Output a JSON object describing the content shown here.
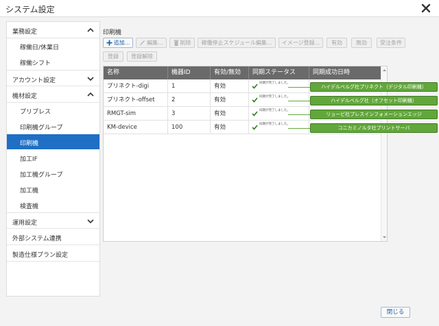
{
  "window": {
    "title": "システム設定"
  },
  "sidebar": {
    "sections": [
      {
        "label": "業務設定",
        "expanded": true,
        "items": [
          "稼働日/休業日",
          "稼働シフト"
        ]
      },
      {
        "label": "アカウント設定",
        "expanded": false,
        "items": []
      },
      {
        "label": "機材設定",
        "expanded": true,
        "items": [
          "プリプレス",
          "印刷機グループ",
          "印刷機",
          "加工IF",
          "加工機グループ",
          "加工機",
          "検査機"
        ]
      },
      {
        "label": "運用設定",
        "expanded": false,
        "items": []
      },
      {
        "label": "外部システム連携",
        "expanded": false,
        "items": []
      },
      {
        "label": "製造仕様プラン設定",
        "expanded": false,
        "items": []
      }
    ],
    "active_item": "印刷機"
  },
  "main": {
    "section_title": "印刷機",
    "toolbar": {
      "add": "追加...",
      "edit": "編集...",
      "delete": "削除",
      "schedule": "稼働停止スケジュール編集...",
      "image_register": "イメージ登録...",
      "enable": "有効",
      "disable": "無効",
      "order_condition": "受注条件",
      "register": "登録",
      "unregister": "登録解除"
    },
    "table": {
      "columns": [
        "名称",
        "機器ID",
        "有効/無効",
        "同期ステータス",
        "同期成功日時"
      ],
      "rows": [
        {
          "name": "プリネクト-digi",
          "id": "1",
          "enabled": "有効",
          "status": "同期が完了しました。",
          "synced_at": ""
        },
        {
          "name": "プリネクト-offset",
          "id": "2",
          "enabled": "有効",
          "status": "同期が完了しました。",
          "synced_at": ""
        },
        {
          "name": "RMGT-sim",
          "id": "3",
          "enabled": "有効",
          "status": "同期が完了しました。",
          "synced_at": ""
        },
        {
          "name": "KM-device",
          "id": "100",
          "enabled": "有効",
          "status": "同期が完了しました。",
          "synced_at": ""
        }
      ]
    }
  },
  "callouts": [
    "ハイデルベルグ社プリネクト（デジタル印刷機）",
    "ハイデルベルグ社（オフセット印刷機）",
    "リョービ社プレスインフォメーションエッジ",
    "コニカミノルタ社プリントサーバ"
  ],
  "footer": {
    "close_label": "閉じる"
  },
  "colors": {
    "active": "#1f6fc5",
    "header": "#6a6a6a",
    "callout": "#62a73b",
    "check": "#2e7d1f"
  }
}
